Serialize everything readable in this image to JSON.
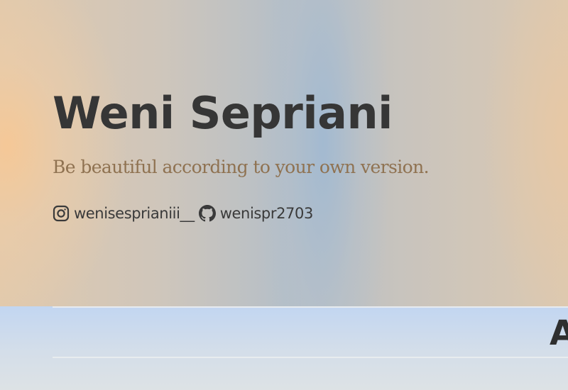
{
  "hero": {
    "title": "Weni Sepriani",
    "subtitle": "Be beautiful according to your own version.",
    "social": {
      "instagram": {
        "icon": "instagram-icon",
        "handle": "wenisesprianiii__"
      },
      "github": {
        "icon": "github-icon",
        "handle": "wenispr2703"
      }
    }
  },
  "section": {
    "heading": "A"
  },
  "colors": {
    "title": "#363636",
    "subtitle": "#8f7251",
    "social_text": "#3a3a3a",
    "hero_peach": "#f6c896",
    "hero_blue": "#a0b9d2",
    "section_top": "#c2d6f1"
  }
}
